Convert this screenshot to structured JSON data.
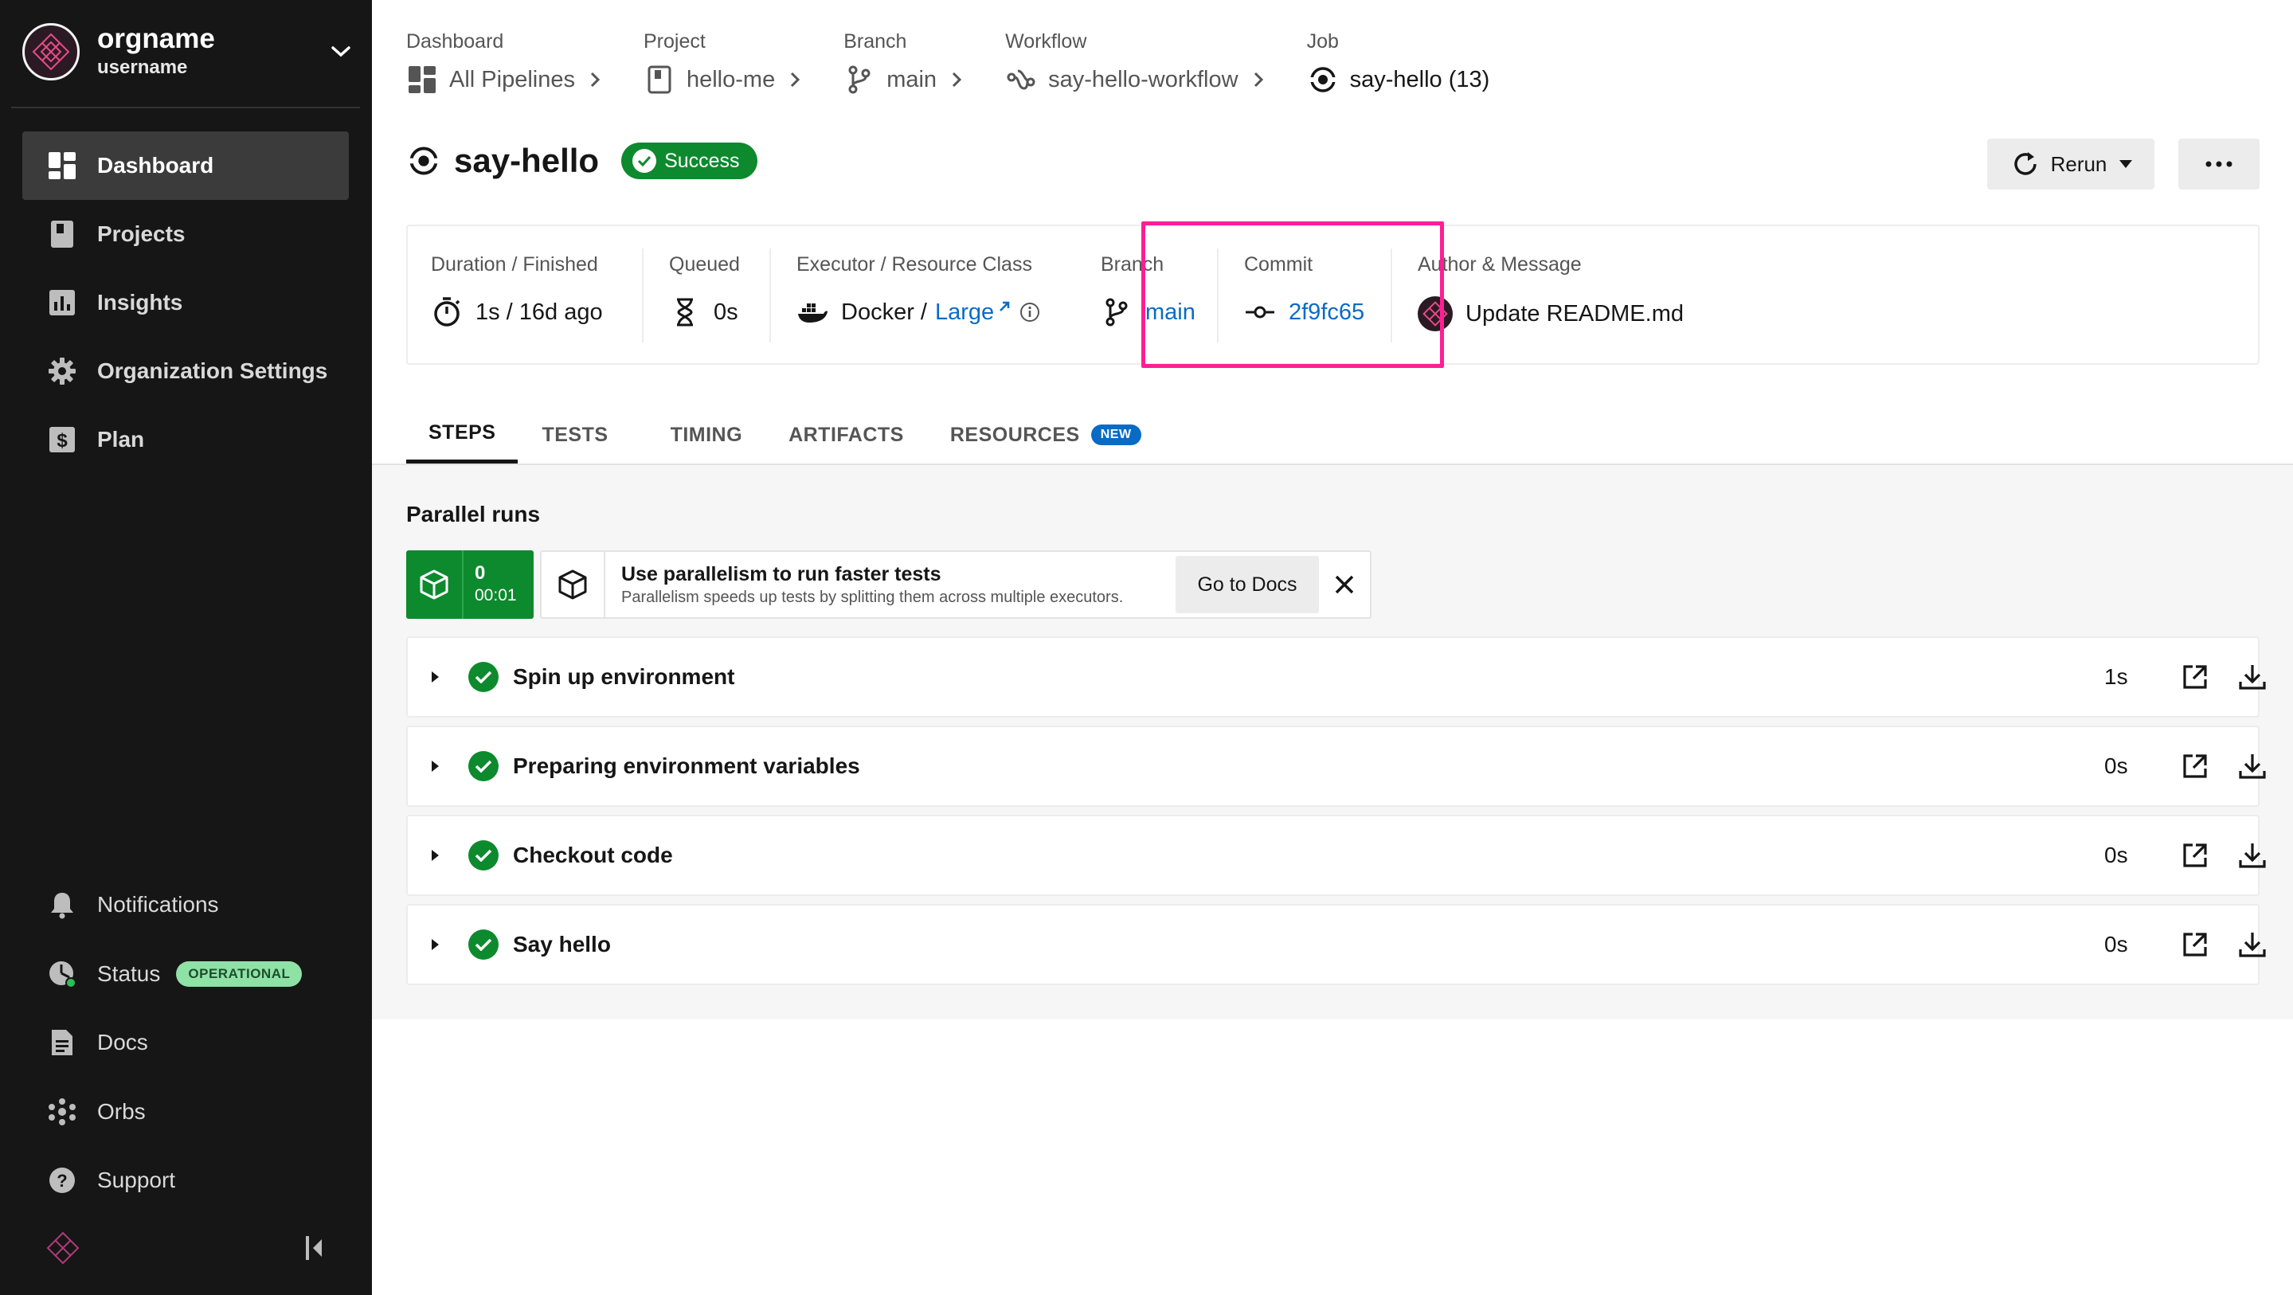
{
  "org": {
    "name": "orgname",
    "user": "username"
  },
  "nav": [
    {
      "label": "Dashboard",
      "icon": "dashboard-icon"
    },
    {
      "label": "Projects",
      "icon": "projects-icon"
    },
    {
      "label": "Insights",
      "icon": "insights-icon"
    },
    {
      "label": "Organization Settings",
      "icon": "gear-icon"
    },
    {
      "label": "Plan",
      "icon": "dollar-icon"
    }
  ],
  "bottom_nav": [
    {
      "label": "Notifications",
      "icon": "bell-icon"
    },
    {
      "label": "Status",
      "icon": "status-icon",
      "badge": "OPERATIONAL"
    },
    {
      "label": "Docs",
      "icon": "doc-icon"
    },
    {
      "label": "Orbs",
      "icon": "orbs-icon"
    },
    {
      "label": "Support",
      "icon": "help-icon"
    }
  ],
  "breadcrumbs": [
    {
      "label": "Dashboard",
      "value": "All Pipelines"
    },
    {
      "label": "Project",
      "value": "hello-me"
    },
    {
      "label": "Branch",
      "value": "main"
    },
    {
      "label": "Workflow",
      "value": "say-hello-workflow"
    },
    {
      "label": "Job",
      "value": "say-hello (13)"
    }
  ],
  "job": {
    "name": "say-hello",
    "status": "Success"
  },
  "actions": {
    "rerun": "Rerun"
  },
  "meta": {
    "duration": {
      "label": "Duration / Finished",
      "value": "1s / 16d ago"
    },
    "queued": {
      "label": "Queued",
      "value": "0s"
    },
    "executor": {
      "label": "Executor / Resource Class",
      "executor": "Docker /",
      "resource_class": "Large"
    },
    "branch": {
      "label": "Branch",
      "value": "main"
    },
    "commit": {
      "label": "Commit",
      "value": "2f9fc65"
    },
    "author": {
      "label": "Author & Message",
      "value": "Update README.md"
    }
  },
  "tabs": [
    {
      "label": "STEPS"
    },
    {
      "label": "TESTS"
    },
    {
      "label": "TIMING"
    },
    {
      "label": "ARTIFACTS"
    },
    {
      "label": "RESOURCES",
      "badge": "NEW"
    }
  ],
  "parallel": {
    "title": "Parallel runs",
    "run_index": "0",
    "run_time": "00:01",
    "tip_title": "Use parallelism to run faster tests",
    "tip_sub": "Parallelism speeds up tests by splitting them across multiple executors.",
    "docs_button": "Go to Docs"
  },
  "steps": [
    {
      "name": "Spin up environment",
      "duration": "1s"
    },
    {
      "name": "Preparing environment variables",
      "duration": "0s"
    },
    {
      "name": "Checkout code",
      "duration": "0s"
    },
    {
      "name": "Say hello",
      "duration": "0s"
    }
  ],
  "colors": {
    "accent": "#0a6bc7",
    "success": "#0d8a2e",
    "highlight": "#ff1e96",
    "sidebar": "#161616"
  }
}
